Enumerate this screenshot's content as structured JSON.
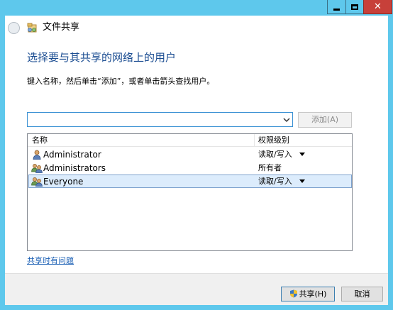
{
  "window": {
    "title": "文件共享",
    "caption_close": "✕"
  },
  "main": {
    "heading": "选择要与其共享的网络上的用户",
    "instruction": "键入名称，然后单击“添加”，或者单击箭头查找用户。",
    "search": {
      "value": "",
      "placeholder": ""
    },
    "add_label": "添加(A)",
    "list": {
      "columns": {
        "name": "名称",
        "permission": "权限级别"
      },
      "rows": [
        {
          "name": "Administrator",
          "permission": "读取/写入",
          "icon": "user-icon",
          "has_dropdown": true,
          "selected": false
        },
        {
          "name": "Administrators",
          "permission": "所有者",
          "icon": "group-icon",
          "has_dropdown": false,
          "selected": false
        },
        {
          "name": "Everyone",
          "permission": "读取/写入",
          "icon": "group-icon",
          "has_dropdown": true,
          "selected": true
        }
      ]
    },
    "help_link": "共享时有问题"
  },
  "footer": {
    "share_label": "共享(H)",
    "cancel_label": "取消"
  },
  "colors": {
    "frame": "#5ec8ec",
    "heading": "#1a4c91",
    "link": "#1a5fb4",
    "close": "#c7403a",
    "selection": "#dcecfc"
  }
}
